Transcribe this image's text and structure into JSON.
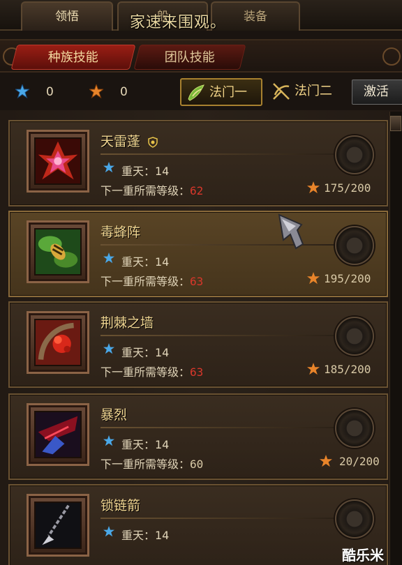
{
  "top_tabs": [
    {
      "label": "领悟",
      "active": true
    },
    {
      "label": "般",
      "active": false
    },
    {
      "label": "装备",
      "active": false
    }
  ],
  "overlay_text": "家速来围观。",
  "category_tabs": [
    {
      "label": "种族技能",
      "active": true
    },
    {
      "label": "团队技能",
      "active": false
    }
  ],
  "stats": {
    "blue_gem": "0",
    "orange_gem": "0"
  },
  "formation_tabs": [
    {
      "label": "法门一",
      "active": true
    },
    {
      "label": "法门二",
      "active": false
    }
  ],
  "activate_label": "激活",
  "colors": {
    "gold": "#f0d591",
    "red_number": "#d8372b",
    "blue_gem": "#4aa8e8",
    "orange_gem": "#e8842a"
  },
  "skills": [
    {
      "name": "天雷蓬",
      "realm": "重天：14",
      "req_label": "下一重所需等级：",
      "req_level": "62",
      "cost": "175/200",
      "icon": "thunder-icon",
      "shield": true,
      "highlighted": false,
      "req_ok": false
    },
    {
      "name": "毒蜂阵",
      "realm": "重天：14",
      "req_label": "下一重所需等级：",
      "req_level": "63",
      "cost": "195/200",
      "icon": "bee-icon",
      "shield": false,
      "highlighted": true,
      "req_ok": false
    },
    {
      "name": "荆棘之墙",
      "realm": "重天：14",
      "req_label": "下一重所需等级：",
      "req_level": "63",
      "cost": "185/200",
      "icon": "thorn-icon",
      "shield": false,
      "highlighted": false,
      "req_ok": false
    },
    {
      "name": "暴烈",
      "realm": "重天：14",
      "req_label": "下一重所需等级：",
      "req_level": "60",
      "cost": "20/200",
      "icon": "fury-icon",
      "shield": false,
      "highlighted": false,
      "req_ok": true
    },
    {
      "name": "锁链箭",
      "realm": "重天：14",
      "req_label": "",
      "req_level": "",
      "cost": "",
      "icon": "chain-arrow-icon",
      "shield": false,
      "highlighted": false,
      "req_ok": false
    }
  ],
  "watermark": "酷乐米"
}
